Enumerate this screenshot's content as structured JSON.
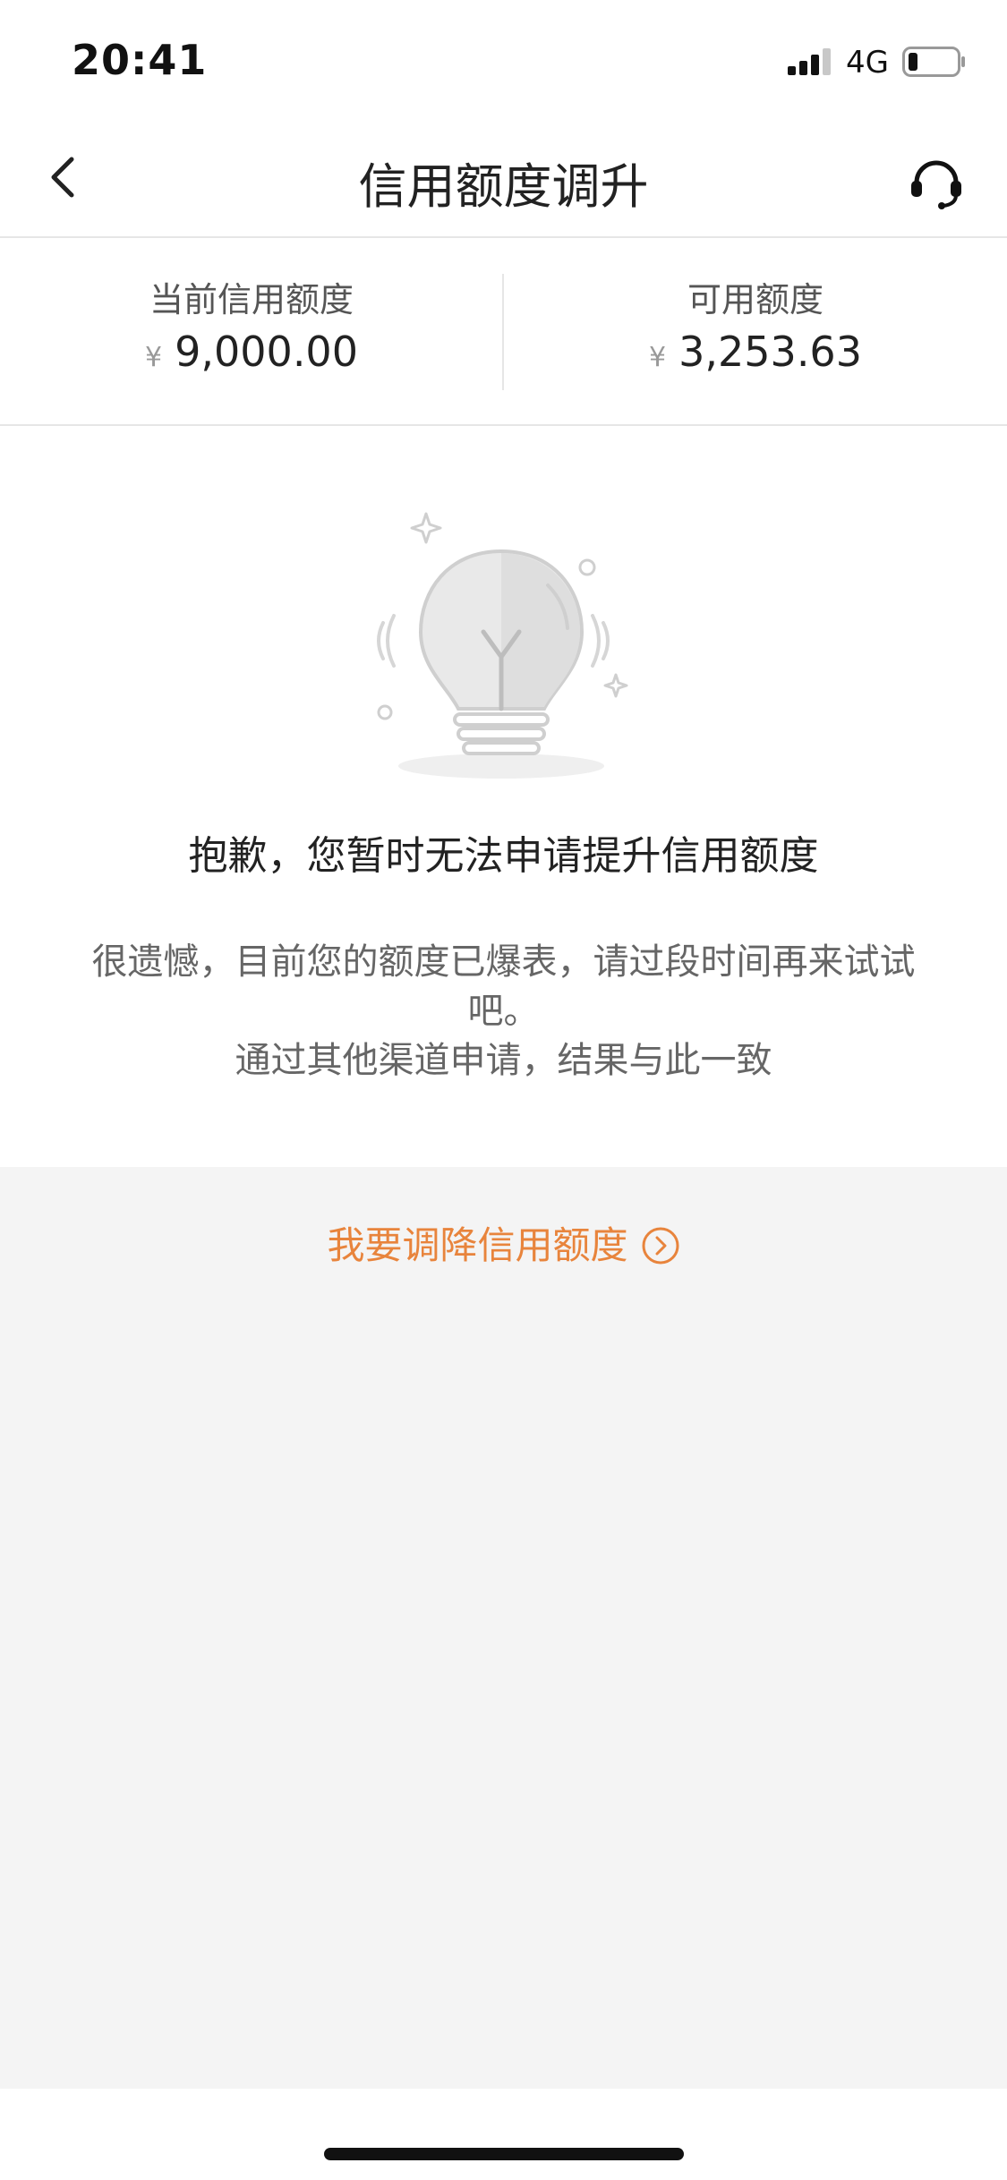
{
  "status_bar": {
    "time": "20:41",
    "network": "4G",
    "signal_icon": "signal-bars-icon",
    "battery_icon": "battery-low-icon"
  },
  "nav": {
    "title": "信用额度调升",
    "back_icon": "chevron-left-icon",
    "service_icon": "headset-icon"
  },
  "summary": {
    "current": {
      "label": "当前信用额度",
      "currency": "¥",
      "amount": "9,000.00"
    },
    "available": {
      "label": "可用额度",
      "currency": "¥",
      "amount": "3,253.63"
    }
  },
  "result": {
    "illustration_icon": "lightbulb-icon",
    "title": "抱歉，您暂时无法申请提升信用额度",
    "desc_line1": "很遗憾，目前您的额度已爆表，请过段时间再来试试",
    "desc_line2": "吧。",
    "desc_line3": "通过其他渠道申请，结果与此一致"
  },
  "actions": {
    "reduce_label": "我要调降信用额度",
    "reduce_icon": "circle-chevron-right-icon"
  },
  "colors": {
    "accent": "#e8843c",
    "background": "#f4f4f4",
    "card": "#ffffff",
    "text_primary": "#222222",
    "text_secondary": "#666666"
  }
}
